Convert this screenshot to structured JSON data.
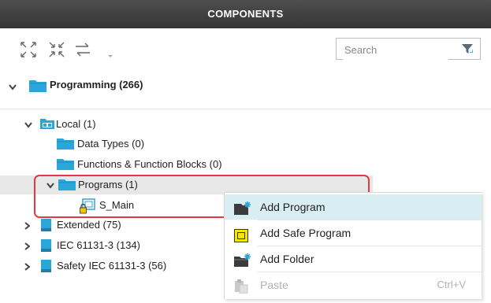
{
  "panel": {
    "title": "COMPONENTS"
  },
  "toolbar": {
    "expand_icon": "expand-all-icon",
    "collapse_icon": "collapse-all-icon",
    "sync_icon": "sync-arrows-icon",
    "search_placeholder": "Search",
    "filter_icon": "filter-funnel-icon"
  },
  "tree": {
    "root": {
      "label": "Programming (266)"
    },
    "local": {
      "label": "Local (1)"
    },
    "data_types": {
      "label": "Data Types (0)"
    },
    "functions": {
      "label": "Functions & Function Blocks (0)"
    },
    "programs": {
      "label": "Programs (1)"
    },
    "s_main": {
      "label": "S_Main"
    },
    "extended": {
      "label": "Extended (75)"
    },
    "iec": {
      "label": "IEC 61131-3 (134)"
    },
    "safety_iec": {
      "label": "Safety IEC 61131-3 (56)"
    }
  },
  "context_menu": {
    "items": [
      {
        "label": "Add Program",
        "icon": "add-program-icon",
        "highlighted": true
      },
      {
        "label": "Add Safe Program",
        "icon": "safe-program-icon"
      },
      {
        "label": "Add Folder",
        "icon": "add-folder-icon"
      },
      {
        "label": "Paste",
        "shortcut": "Ctrl+V",
        "icon": "paste-icon",
        "disabled": true
      }
    ]
  },
  "colors": {
    "header_bg": "#3d3d3d",
    "folder": "#2aa6d8",
    "highlight_outline": "#e63840",
    "menu_hover": "#d9eef3",
    "selected_row": "#e8e8e8"
  }
}
